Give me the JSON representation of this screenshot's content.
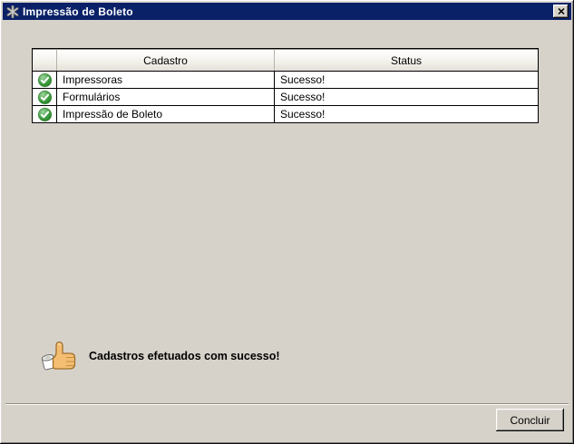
{
  "window": {
    "title": "Impressão de Boleto",
    "close_icon": "close-icon"
  },
  "table": {
    "columns": [
      {
        "label": ""
      },
      {
        "label": "Cadastro"
      },
      {
        "label": "Status"
      }
    ],
    "rows": [
      {
        "icon": "success-check-icon",
        "cadastro": "Impressoras",
        "status": "Sucesso!"
      },
      {
        "icon": "success-check-icon",
        "cadastro": "Formulários",
        "status": "Sucesso!"
      },
      {
        "icon": "success-check-icon",
        "cadastro": "Impressão de Boleto",
        "status": "Sucesso!"
      }
    ]
  },
  "message": {
    "icon": "thumbs-up-icon",
    "text": "Cadastros efetuados com sucesso!"
  },
  "footer": {
    "confirm_label": "Concluir"
  },
  "colors": {
    "titlebar": "#0A2168",
    "dialog_bg": "#D6D2CA",
    "success_green": "#3C9E3C",
    "row_bg": "#FFFFFF"
  }
}
